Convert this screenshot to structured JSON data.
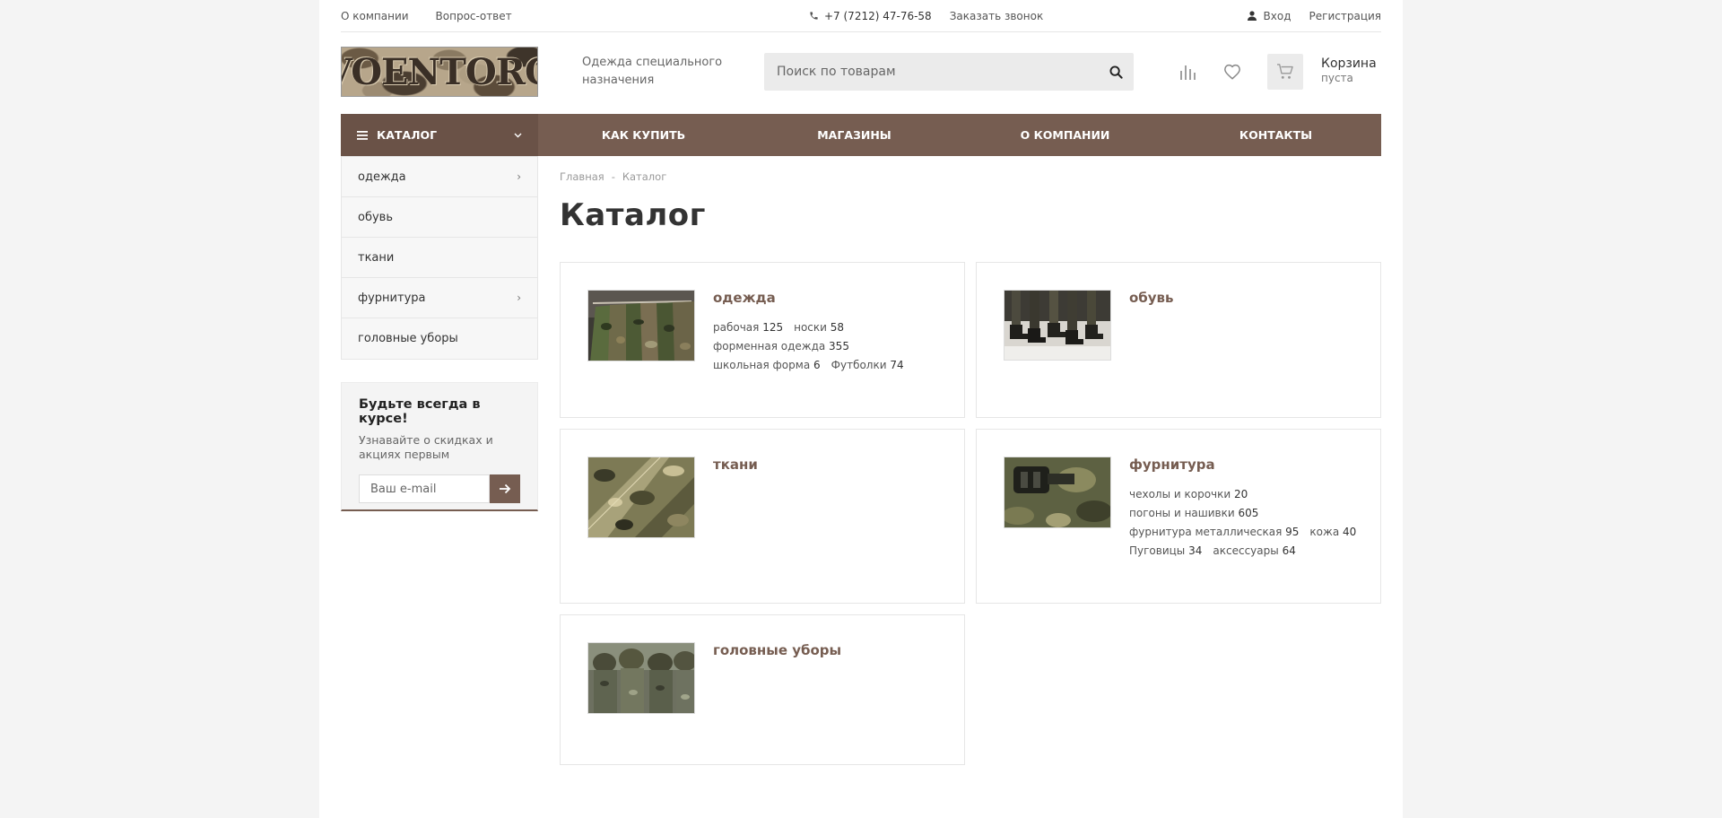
{
  "topbar": {
    "links": [
      "О компании",
      "Вопрос-ответ"
    ],
    "phone": "+7 (7212) 47-76-58",
    "callback": "Заказать звонок",
    "login": "Вход",
    "register": "Регистрация"
  },
  "header": {
    "logo_text": "VOENTORG",
    "slogan": "Одежда специального назначения",
    "search_placeholder": "Поиск по товарам",
    "cart_title": "Корзина",
    "cart_status": "пуста"
  },
  "nav": {
    "catalog": "КАТАЛОГ",
    "items": [
      "КАК КУПИТЬ",
      "МАГАЗИНЫ",
      "О КОМПАНИИ",
      "КОНТАКТЫ"
    ]
  },
  "sidemenu": [
    {
      "label": "одежда",
      "has_children": true
    },
    {
      "label": "обувь",
      "has_children": false
    },
    {
      "label": "ткани",
      "has_children": false
    },
    {
      "label": "фурнитура",
      "has_children": true
    },
    {
      "label": "головные уборы",
      "has_children": false
    }
  ],
  "subscribe": {
    "title": "Будьте всегда в курсе!",
    "text": "Узнавайте о скидках и акциях первым",
    "placeholder": "Ваш e-mail"
  },
  "breadcrumbs": [
    "Главная",
    "Каталог"
  ],
  "breadcrumb_sep": "-",
  "page_title": "Каталог",
  "categories": [
    {
      "title": "одежда",
      "subs": [
        [
          "рабочая",
          "125"
        ],
        [
          "носки",
          "58"
        ],
        [
          "форменная одежда",
          "355"
        ],
        [
          "школьная форма",
          "6"
        ],
        [
          "Футболки",
          "74"
        ]
      ]
    },
    {
      "title": "обувь",
      "subs": []
    },
    {
      "title": "ткани",
      "subs": []
    },
    {
      "title": "фурнитура",
      "subs": [
        [
          "чехолы и корочки",
          "20"
        ],
        [
          "погоны и нашивки",
          "605"
        ],
        [
          "фурнитура металлическая",
          "95"
        ],
        [
          "кожа",
          "40"
        ],
        [
          "Пуговицы",
          "34"
        ],
        [
          "аксессуары",
          "64"
        ]
      ]
    },
    {
      "title": "головные уборы",
      "subs": []
    }
  ],
  "colors": {
    "accent": "#765d51",
    "nav_dark": "#6a5247"
  }
}
